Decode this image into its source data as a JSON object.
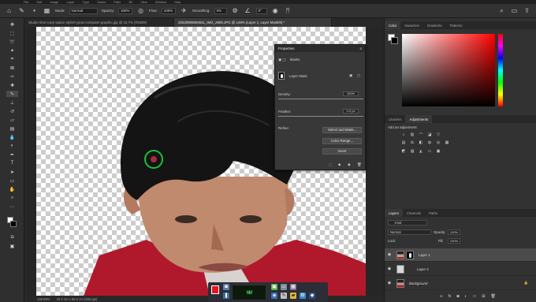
{
  "menubar": {
    "items": [
      "File",
      "Edit",
      "Image",
      "Layer",
      "Type",
      "Select",
      "Filter",
      "3D",
      "View",
      "Window",
      "Help"
    ]
  },
  "options_bar": {
    "mode_label": "Mode:",
    "mode_value": "Normal",
    "opacity_label": "Opacity:",
    "opacity_value": "100%",
    "flow_label": "Flow:",
    "flow_value": "100%",
    "smoothing_label": "Smoothing:",
    "smoothing_value": "0%",
    "angle_value": "0°"
  },
  "tabs": [
    {
      "label": "Studio-shot-copy-space-stylish-grow-computer-graphic.jpg @ 16,7% (RGB/8)",
      "active": false
    },
    {
      "label": "20220906094611_IMG_2805.JPG @ 149% (Layer 1, Layer Mask/8) *",
      "active": true
    }
  ],
  "status": {
    "zoom": "148.89%",
    "doc_size": "33.2 cm x 55.2 cm (300 ppi)"
  },
  "properties": {
    "title": "Properties",
    "section": "Masks",
    "mask_label": "Layer Mask",
    "density_label": "Density:",
    "density_value": "100%",
    "feather_label": "Feather:",
    "feather_value": "0.0 px",
    "refine_label": "Refine:",
    "btn_select_mask": "Select and Mask...",
    "btn_color_range": "Color Range...",
    "btn_invert": "Invert"
  },
  "color_panel": {
    "tabs": [
      "Color",
      "Swatches",
      "Gradients",
      "Patterns"
    ],
    "fg": "#ffffff",
    "bg": "#000000",
    "hue": "#ff0000"
  },
  "adjust_panel": {
    "tabs": [
      "Libraries",
      "Adjustments"
    ],
    "add_label": "Add an adjustment"
  },
  "layers_panel": {
    "tabs": [
      "Layers",
      "Channels",
      "Paths"
    ],
    "kind_label": "Kind",
    "blend_mode": "Normal",
    "opacity_label": "Opacity:",
    "opacity_value": "100%",
    "lock_label": "Lock:",
    "fill_label": "Fill:",
    "fill_value": "100%",
    "layers": [
      {
        "name": "Layer 1",
        "active": true
      },
      {
        "name": "Layer 2",
        "active": false
      },
      {
        "name": "Background",
        "active": false
      }
    ]
  },
  "taskbar": {
    "wave_text": "WW"
  },
  "colors": {
    "brush_ring": "#1fbf3a",
    "record": "#e8141c"
  }
}
